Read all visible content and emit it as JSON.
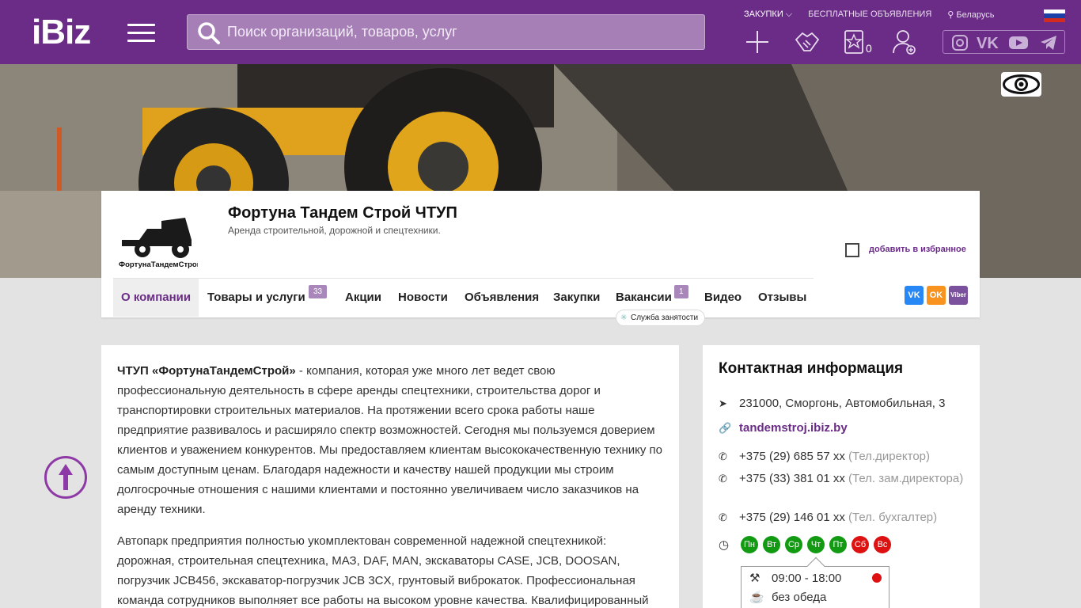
{
  "header": {
    "logo": "iBiz",
    "search_placeholder": "Поиск организаций, товаров, услуг",
    "links": [
      "ЗАКУПКИ ⌵",
      "БЕСПЛАТНЫЕ ОБЪЯВЛЕНИЯ",
      "Беларусь"
    ],
    "favorites_count": "0",
    "brand_color": "#6a2c86",
    "icons": [
      "menu-icon",
      "search-icon",
      "plus-icon",
      "handshake-icon",
      "star-icon",
      "user-add-icon",
      "instagram-icon",
      "vk-icon",
      "youtube-icon",
      "telegram-icon",
      "flag-icon",
      "location-icon"
    ]
  },
  "company": {
    "logo_text": "ФортунаТандемСтрой",
    "name": "Фортуна Тандем Строй ЧТУП",
    "description": "Аренда строительной, дорожной и спецтехники.",
    "favorite_label": "добавить в избранное"
  },
  "tabs": [
    {
      "label": "О компании",
      "active": true
    },
    {
      "label": "Товары и услуги",
      "badge": "33"
    },
    {
      "label": "Акции"
    },
    {
      "label": "Новости"
    },
    {
      "label": "Объявления"
    },
    {
      "label": "Закупки"
    },
    {
      "label": "Вакансии",
      "badge": "1"
    },
    {
      "label": "Видео"
    },
    {
      "label": "Отзывы"
    }
  ],
  "employment_tooltip": "Служба занятости",
  "share": [
    {
      "label": "VK",
      "color": "#2787f5"
    },
    {
      "label": "OK",
      "color": "#f7931e"
    },
    {
      "label": "Viber",
      "color": "#7b519d"
    }
  ],
  "about": {
    "p1_bold": "ЧТУП «ФортунаТандемСтрой»",
    "p1_rest": " - компания, которая уже много лет ведет свою профессиональную деятельность в сфере аренды спецтехники, строительства дорог и транспортировки строительных материалов. На протяжении всего срока работы наше предприятие развивалось и расширяло спектр возможностей. Сегодня мы пользуемся доверием клиентов и уважением конкурентов. Мы предоставляем клиентам высококачественную технику по самым доступным ценам. Благодаря надежности и качеству нашей продукции мы строим долгосрочные отношения с нашими клиентами и постоянно увеличиваем число заказчиков на аренду техники.",
    "p2": "Автопарк предприятия полностью укомплектован современной надежной спецтехникой: дорожная, строительная спецтехника, МАЗ, DAF, MAN, экскаваторы CASE, JCB, DOOSAN, погрузчик JCB456, экскаватор-погрузчик JCB 3CX, грунтовый виброкаток. Профессиональная команда сотрудников выполняет все работы на высоком уровне качества. Квалифицированный персонал"
  },
  "contacts": {
    "title": "Контактная информация",
    "address": "231000, Сморгонь, Автомобильная, 3",
    "site": "tandemstroj.ibiz.by",
    "phones": [
      {
        "number": "+375 (29) 685 57 xx",
        "note": "(Тел.директор)"
      },
      {
        "number": "+375 (33) 381 01 xx",
        "note": "(Тел. зам.директора)"
      },
      {
        "number": "+375 (29) 146 01 xx",
        "note": "(Тел. бухгалтер)"
      }
    ],
    "days": [
      {
        "label": "Пн",
        "open": true
      },
      {
        "label": "Вт",
        "open": true
      },
      {
        "label": "Ср",
        "open": true
      },
      {
        "label": "Чт",
        "open": true
      },
      {
        "label": "Пт",
        "open": true
      },
      {
        "label": "Сб",
        "open": false
      },
      {
        "label": "Вс",
        "open": false
      }
    ],
    "hours": "09:00 - 18:00",
    "lunch": "без обеда"
  }
}
